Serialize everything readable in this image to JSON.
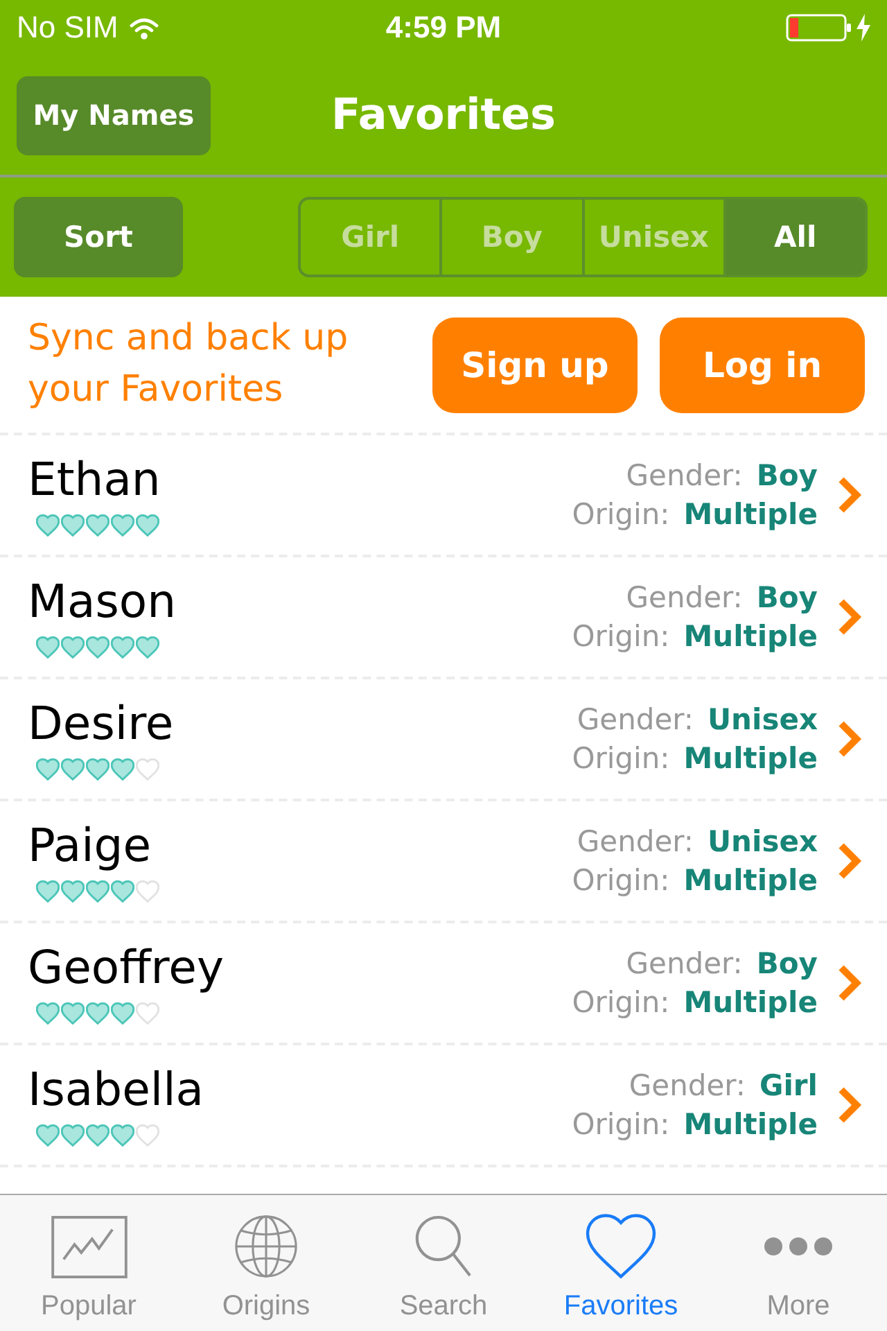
{
  "status_bar": {
    "carrier": "No SIM",
    "time": "4:59 PM"
  },
  "nav_bar": {
    "left_button": "My Names",
    "title": "Favorites"
  },
  "filter_bar": {
    "sort_button": "Sort",
    "segments": [
      {
        "label": "Girl",
        "selected": false
      },
      {
        "label": "Boy",
        "selected": false
      },
      {
        "label": "Unisex",
        "selected": false
      },
      {
        "label": "All",
        "selected": true
      }
    ]
  },
  "sync_banner": {
    "message": "Sync and back up your Favorites",
    "buttons": [
      "Sign up",
      "Log in"
    ]
  },
  "names": [
    {
      "name": "Ethan",
      "stars": 5,
      "gender_label": "Gender:",
      "gender": "Boy",
      "origin_label": "Origin:",
      "origin": "Multiple"
    },
    {
      "name": "Mason",
      "stars": 5,
      "gender_label": "Gender:",
      "gender": "Boy",
      "origin_label": "Origin:",
      "origin": "Multiple"
    },
    {
      "name": "Desire",
      "stars": 4,
      "gender_label": "Gender:",
      "gender": "Unisex",
      "origin_label": "Origin:",
      "origin": "Multiple"
    },
    {
      "name": "Paige",
      "stars": 4,
      "gender_label": "Gender:",
      "gender": "Unisex",
      "origin_label": "Origin:",
      "origin": "Multiple"
    },
    {
      "name": "Geoffrey",
      "stars": 4,
      "gender_label": "Gender:",
      "gender": "Boy",
      "origin_label": "Origin:",
      "origin": "Multiple"
    },
    {
      "name": "Isabella",
      "stars": 4,
      "gender_label": "Gender:",
      "gender": "Girl",
      "origin_label": "Origin:",
      "origin": "Multiple"
    }
  ],
  "tab_bar": [
    {
      "label": "Popular",
      "kind": "chart",
      "selected": false
    },
    {
      "label": "Origins",
      "kind": "globe",
      "selected": false
    },
    {
      "label": "Search",
      "kind": "search",
      "selected": false
    },
    {
      "label": "Favorites",
      "kind": "heart",
      "selected": true
    },
    {
      "label": "More",
      "kind": "more",
      "selected": false
    }
  ]
}
